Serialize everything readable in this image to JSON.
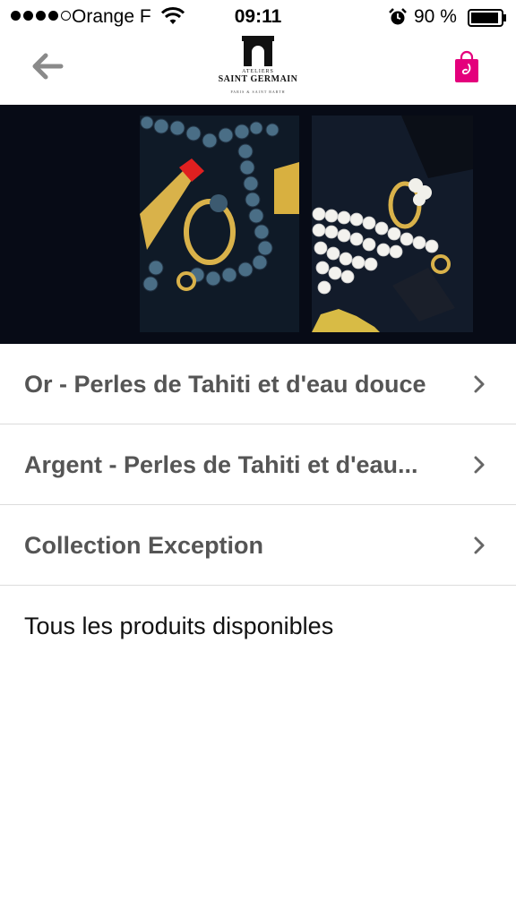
{
  "status_bar": {
    "carrier": "Orange F",
    "time": "09:11",
    "battery": "90 %"
  },
  "header": {
    "logo_line1": "ATELIERS",
    "logo_line2": "SAINT GERMAIN",
    "logo_line3": "PARIS & SAINT BARTH",
    "back_icon": "arrow-left-icon",
    "cart_icon": "shopping-bag-icon",
    "brand_color": "#e4007c"
  },
  "menu": {
    "items": [
      {
        "label": "Or - Perles de Tahiti et d'eau douce"
      },
      {
        "label": "Argent - Perles de Tahiti et d'eau..."
      },
      {
        "label": "Collection Exception"
      },
      {
        "label": "Tous les produits disponibles"
      }
    ]
  }
}
